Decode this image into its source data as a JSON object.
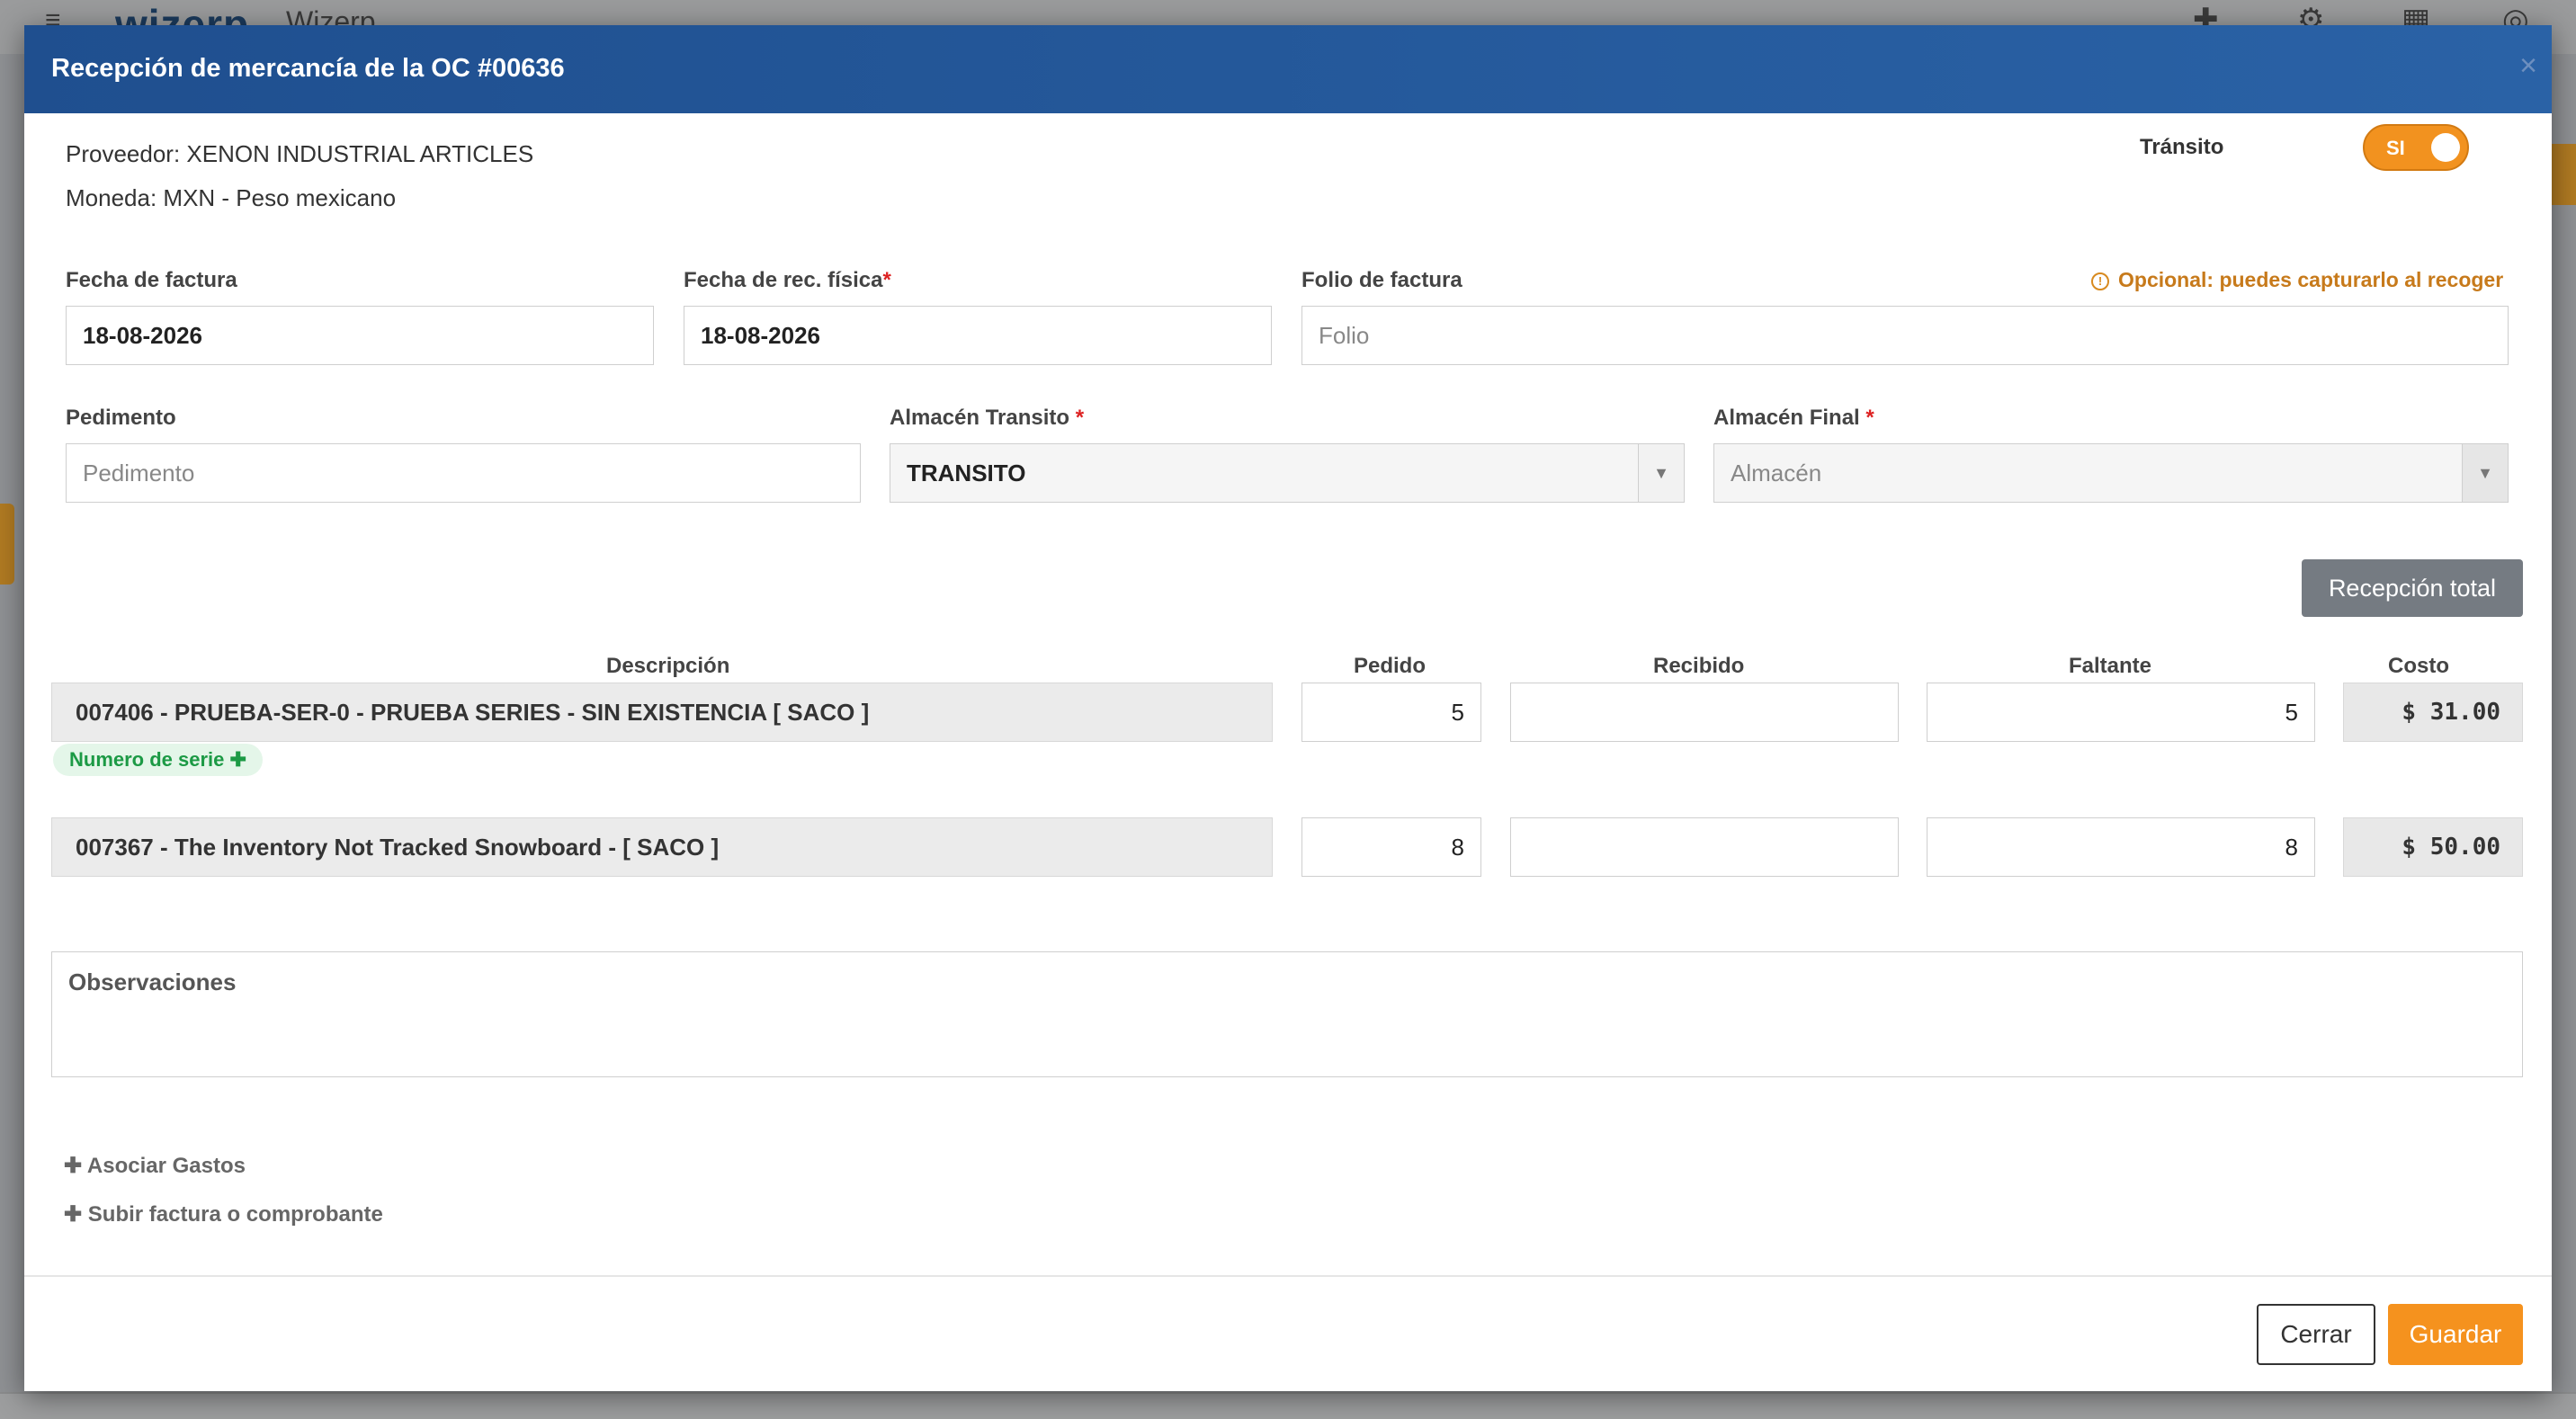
{
  "background_app": {
    "app_name": "Wizerp",
    "logo_text": "wizerp",
    "menu_icon": "hamburger-icon",
    "top_icons": [
      "plus-icon",
      "gear-icon",
      "calendar-icon",
      "help-icon"
    ]
  },
  "modal": {
    "title": "Recepción de mercancía de la OC #00636",
    "close_label": "×",
    "proveedor": "Proveedor: XENON INDUSTRIAL ARTICLES",
    "moneda": "Moneda: MXN - Peso mexicano",
    "transito": {
      "label": "Tránsito",
      "value": "SI"
    },
    "fields": {
      "fecha_factura": {
        "label": "Fecha de factura",
        "value": "18-08-2026"
      },
      "fecha_rec": {
        "label": "Fecha de rec. física",
        "required": "*",
        "value": "18-08-2026"
      },
      "folio": {
        "label": "Folio de factura",
        "placeholder": "Folio",
        "hint": "Opcional: puedes capturarlo al recoger"
      },
      "pedimento": {
        "label": "Pedimento",
        "placeholder": "Pedimento"
      },
      "almacen_transito": {
        "label": "Almacén Transito ",
        "required": "*",
        "value": "TRANSITO"
      },
      "almacen_final": {
        "label": "Almacén Final ",
        "required": "*",
        "placeholder": "Almacén"
      }
    },
    "recepcion_total_label": "Recepción total",
    "table": {
      "headers": {
        "descripcion": "Descripción",
        "pedido": "Pedido",
        "recibido": "Recibido",
        "faltante": "Faltante",
        "costo": "Costo"
      },
      "rows": [
        {
          "descripcion": "007406 - PRUEBA-SER-0 - PRUEBA SERIES - SIN EXISTENCIA [ SACO ]",
          "pedido": "5",
          "recibido": "",
          "faltante": "5",
          "costo": "$ 31.00",
          "serial_link": "Numero de serie ✚"
        },
        {
          "descripcion": "007367 - The Inventory Not Tracked Snowboard - [ SACO ]",
          "pedido": "8",
          "recibido": "",
          "faltante": "8",
          "costo": "$ 50.00"
        }
      ]
    },
    "observaciones_placeholder": "Observaciones",
    "links": {
      "asociar_gastos": "✚ Asociar Gastos",
      "subir_factura": "✚ Subir factura o comprobante"
    },
    "buttons": {
      "cerrar": "Cerrar",
      "guardar": "Guardar"
    },
    "colors": {
      "header": "#2a62a6",
      "accent": "#f5921e",
      "success": "#1c9a45"
    }
  }
}
